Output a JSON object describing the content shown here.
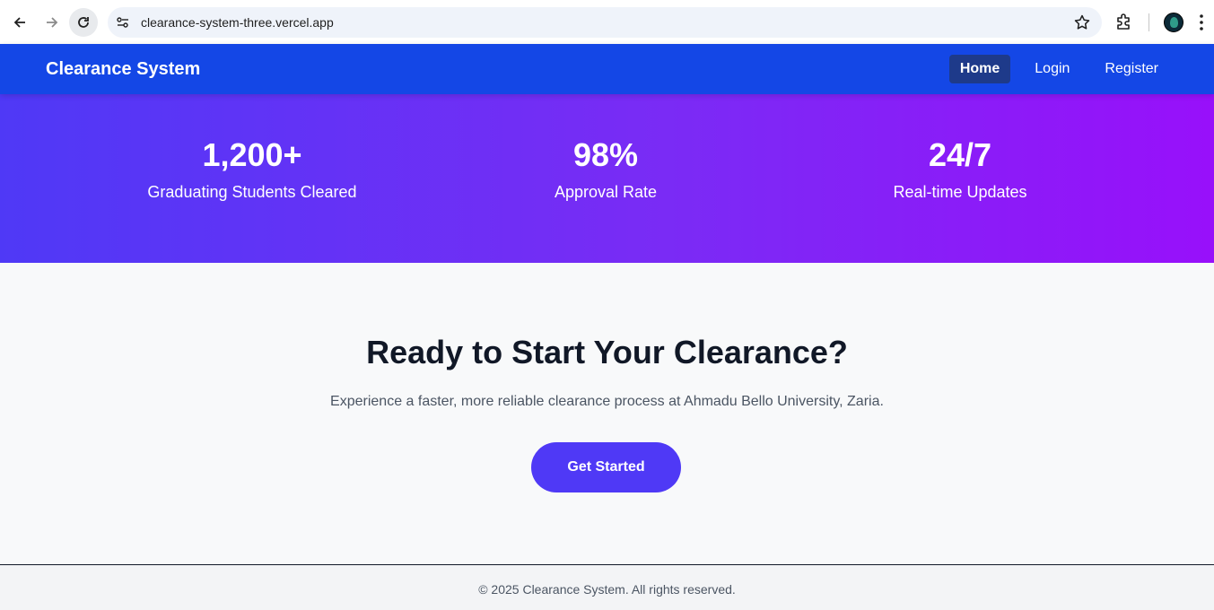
{
  "browser": {
    "url": "clearance-system-three.vercel.app",
    "icons": [
      "back-icon",
      "forward-icon",
      "reload-icon",
      "site-info-icon",
      "star-icon",
      "extensions-icon",
      "profile-avatar",
      "more-icon"
    ]
  },
  "header": {
    "brand": "Clearance System",
    "nav": {
      "home": "Home",
      "login": "Login",
      "register": "Register"
    },
    "bg_color": "#1447e6",
    "active_color": "#1e3a8a"
  },
  "stats": [
    {
      "value": "1,200+",
      "label": "Graduating Students Cleared"
    },
    {
      "value": "98%",
      "label": "Approval Rate"
    },
    {
      "value": "24/7",
      "label": "Real-time Updates"
    }
  ],
  "cta": {
    "title": "Ready to Start Your Clearance?",
    "subtitle": "Experience a faster, more reliable clearance process at Ahmadu Bello University, Zaria.",
    "button": "Get Started",
    "button_color": "#4f39f6"
  },
  "footer": {
    "text": "© 2025 Clearance System. All rights reserved."
  }
}
